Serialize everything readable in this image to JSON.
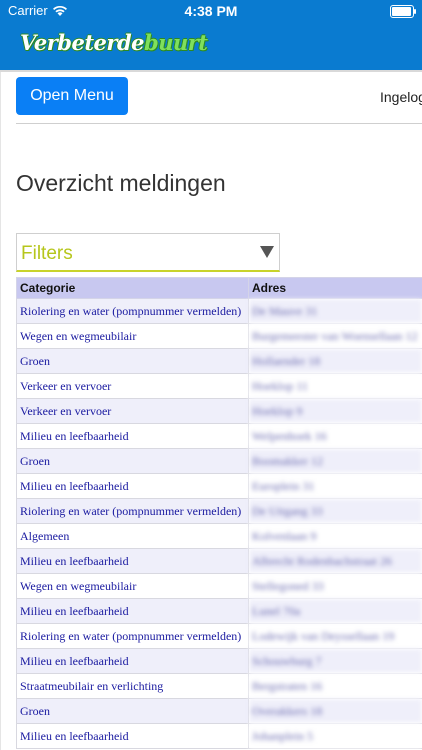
{
  "status_bar": {
    "carrier": "Carrier",
    "time": "4:38 PM",
    "wifi_icon": "wifi-icon",
    "battery_icon": "battery-icon"
  },
  "brand": {
    "logo_part1": "Verbeterde",
    "logo_part2": "buurt"
  },
  "header": {
    "menu_button": "Open Menu",
    "logged_in": "Ingelogd"
  },
  "page": {
    "title": "Overzicht meldingen"
  },
  "filters": {
    "label": "Filters",
    "arrow_icon": "triangle-down-icon"
  },
  "table": {
    "columns": [
      "Categorie",
      "Adres"
    ],
    "rows": [
      {
        "categorie": "Riolering en water (pompnummer vermelden)",
        "adres": "De Mauve 31"
      },
      {
        "categorie": "Wegen en wegmeubilair",
        "adres": "Burgemeester van Woensellaan 12"
      },
      {
        "categorie": "Groen",
        "adres": "Hollaender 18"
      },
      {
        "categorie": "Verkeer en vervoer",
        "adres": "Hoeklop 11"
      },
      {
        "categorie": "Verkeer en vervoer",
        "adres": "Hoeklop 9"
      },
      {
        "categorie": "Milieu en leefbaarheid",
        "adres": "Welpenhoek 16"
      },
      {
        "categorie": "Groen",
        "adres": "Boomakker 12"
      },
      {
        "categorie": "Milieu en leefbaarheid",
        "adres": "Europlein 31"
      },
      {
        "categorie": "Riolering en water (pompnummer vermelden)",
        "adres": "De Uitgang 33"
      },
      {
        "categorie": "Algemeen",
        "adres": "Kolvenlaan 9"
      },
      {
        "categorie": "Milieu en leefbaarheid",
        "adres": "Albrecht Rodenbachstraat 26"
      },
      {
        "categorie": "Wegen en wegmeubilair",
        "adres": "Stellegoned 33"
      },
      {
        "categorie": "Milieu en leefbaarheid",
        "adres": "Lunel 70a"
      },
      {
        "categorie": "Riolering en water (pompnummer vermelden)",
        "adres": "Lodewijk van Deyssellaan 19"
      },
      {
        "categorie": "Milieu en leefbaarheid",
        "adres": "Schouwburg 7"
      },
      {
        "categorie": "Straatmeubilair en verlichting",
        "adres": "Bergstraten 16"
      },
      {
        "categorie": "Groen",
        "adres": "Overakkers 18"
      },
      {
        "categorie": "Milieu en leefbaarheid",
        "adres": "Johanplein 5"
      }
    ]
  }
}
